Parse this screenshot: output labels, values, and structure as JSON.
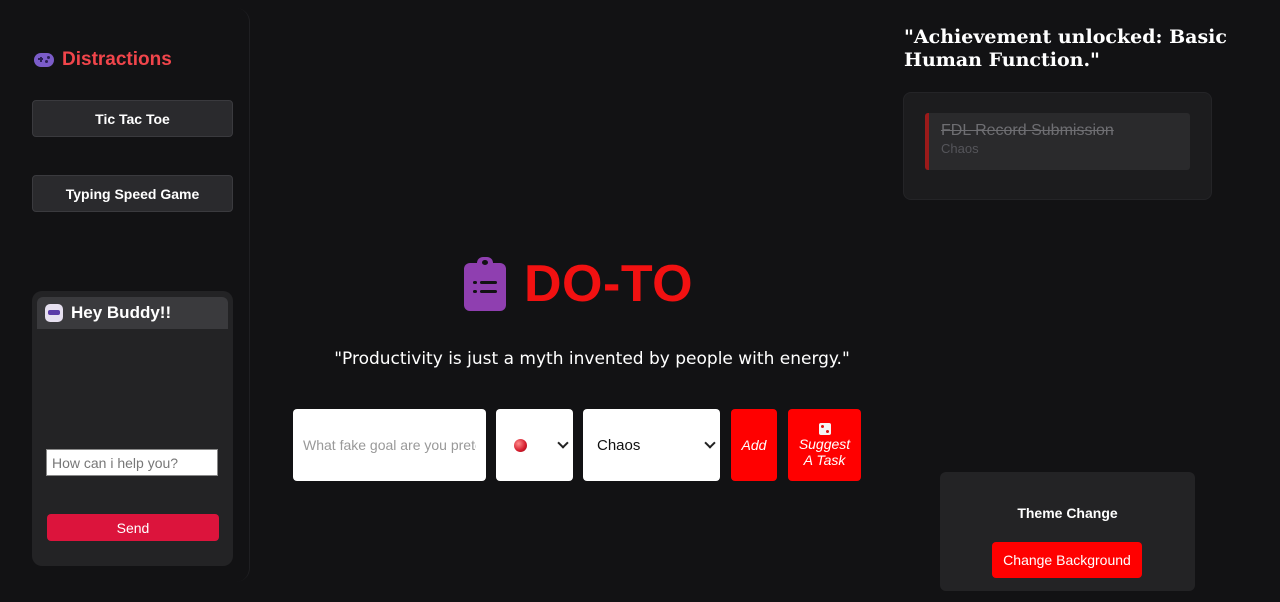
{
  "sidebar": {
    "title": "Distractions",
    "title_icon": "gamepad-icon",
    "games": [
      {
        "label": "Tic Tac Toe"
      },
      {
        "label": "Typing Speed Game"
      }
    ]
  },
  "chat": {
    "title": "Hey Buddy!!",
    "icon": "robot-icon",
    "input_placeholder": "How can i help you?",
    "input_value": "",
    "send_label": "Send"
  },
  "main": {
    "brand_icon": "clipboard-list-icon",
    "brand_title": "DO-TO",
    "quote": "\"Productivity is just a myth invented by people with energy.\"",
    "task_placeholder": "What fake goal are you pretending to do?",
    "task_value": "",
    "priority_selected": "red-dot",
    "category_selected": "Chaos",
    "add_label": "Add",
    "suggest_label": "Suggest A Task",
    "suggest_icon": "dice-icon"
  },
  "right": {
    "achievement": "\"Achievement unlocked: Basic Human Function.\"",
    "completed_tasks": [
      {
        "title": "FDL Record Submission",
        "category": "Chaos"
      }
    ],
    "theme": {
      "title": "Theme Change",
      "button_label": "Change Background"
    }
  },
  "colors": {
    "background": "#121214",
    "accent_red": "#ff0000",
    "brand_red": "#f21111",
    "sidebar_title": "#f0454b",
    "send_button": "#dc143c",
    "clipboard_purple": "#8f3fb0"
  }
}
